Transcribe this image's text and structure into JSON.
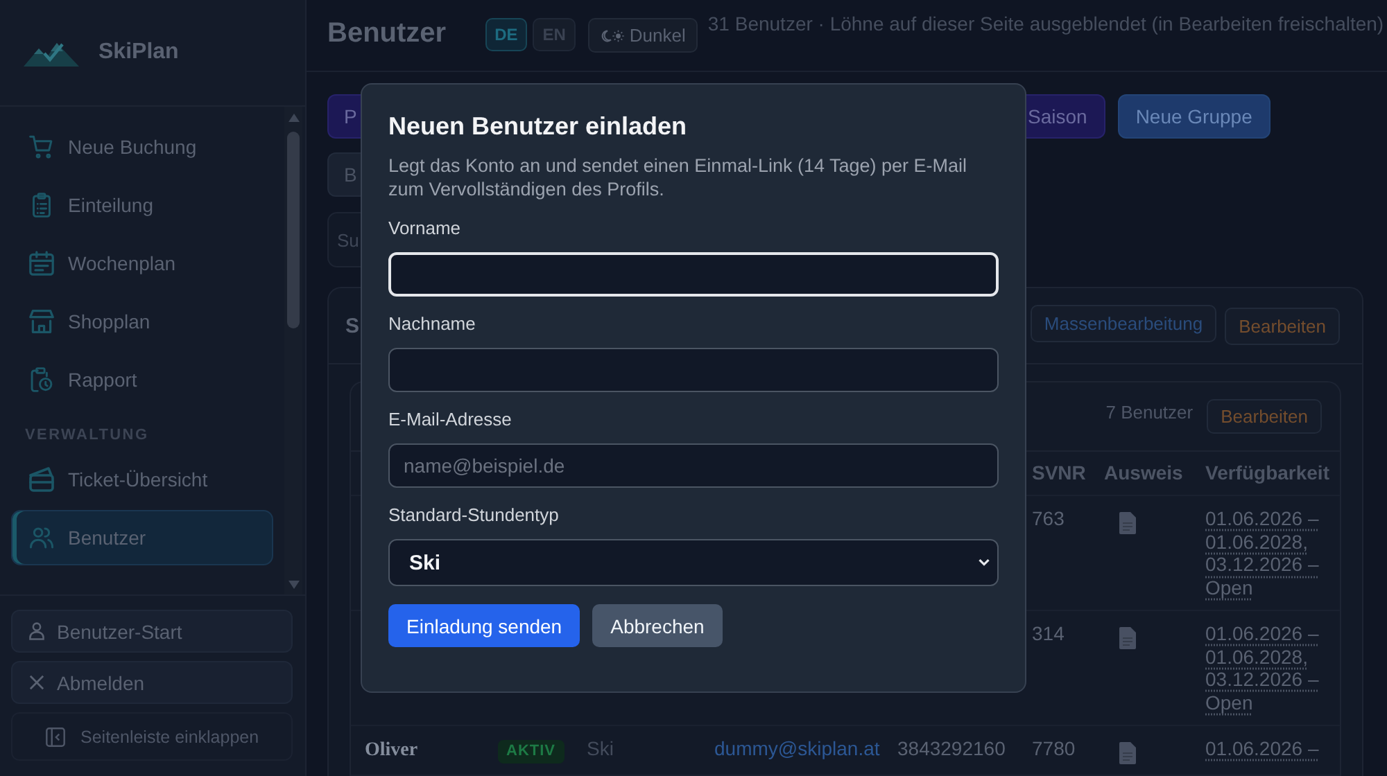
{
  "sidebar": {
    "brand": "SkiPlan",
    "sections": [
      {
        "items": [
          {
            "label": "Neue Buchung",
            "selected": false
          },
          {
            "label": "Einteilung",
            "selected": false
          },
          {
            "label": "Wochenplan",
            "selected": false
          },
          {
            "label": "Shopplan",
            "selected": false
          },
          {
            "label": "Rapport",
            "selected": false
          }
        ]
      },
      {
        "title": "VERWALTUNG",
        "items": [
          {
            "label": "Ticket-Übersicht",
            "selected": false
          },
          {
            "label": "Benutzer",
            "selected": true
          }
        ]
      }
    ],
    "footer": [
      {
        "kind": "user",
        "label": "Benutzer-Start"
      },
      {
        "kind": "logout",
        "label": "Abmelden"
      },
      {
        "kind": "collapse",
        "label": "Seitenleiste einklappen"
      }
    ]
  },
  "header": {
    "title": "Benutzer",
    "languages": [
      {
        "label": "DE",
        "selected": true
      },
      {
        "label": "EN",
        "selected": false
      }
    ],
    "theme_button": "Dunkel",
    "info": "31 Benutzer · Löhne auf dieser Seite ausgeblendet (in Bearbeiten freischalten)"
  },
  "toolbar": {
    "rows": [
      [
        {
          "kind": "accent",
          "label": "P"
        },
        {
          "kind": "accent",
          "label": "Saison"
        },
        {
          "kind": "primary",
          "label": "Neue Gruppe"
        }
      ],
      [
        {
          "kind": "secondary",
          "label": "B"
        }
      ]
    ]
  },
  "search": {
    "placeholder": "Su"
  },
  "card": {
    "title": "S",
    "buttons": [
      {
        "kind": "info",
        "label": "Massenbearbeitung"
      },
      {
        "kind": "warning",
        "label": "Bearbeiten"
      }
    ],
    "group": {
      "count": "7 Benutzer",
      "edit_button": "Bearbeiten",
      "columns": [
        "SVNR",
        "Ausweis",
        "Verfügbarkeit"
      ],
      "rows": [
        {
          "svnr": "763",
          "id_document": true,
          "availability": "01.06.2026 – 01.06.2028, 03.12.2026 – Open"
        },
        {
          "svnr": "314",
          "id_document": true,
          "availability": "01.06.2026 – 01.06.2028, 03.12.2026 – Open"
        },
        {
          "column_1": "Oliver",
          "column_2": "AKTIV",
          "column_3": "Ski",
          "column_4": "dummy@skiplan.at",
          "column_5": "3843292160",
          "svnr": "7780",
          "id_document": true,
          "availability": "01.06.2026 –"
        }
      ]
    }
  },
  "dialog": {
    "title": "Neuen Benutzer einladen",
    "description": "Legt das Konto an und sendet einen Einmal-Link (14 Tage) per E-Mail zum Vervollständigen des Profils.",
    "fields": [
      {
        "kind": "text",
        "label": "Vorname",
        "focused": true
      },
      {
        "kind": "text",
        "label": "Nachname",
        "focused": false
      },
      {
        "kind": "text",
        "label": "E-Mail-Adresse",
        "placeholder": "name@beispiel.de",
        "focused": false
      },
      {
        "kind": "select",
        "label": "Standard-Stundentyp",
        "value": "Ski",
        "focused": false
      }
    ],
    "buttons": [
      {
        "kind": "primary",
        "label": "Einladung senden"
      },
      {
        "kind": "secondary",
        "label": "Abbrechen"
      }
    ]
  }
}
